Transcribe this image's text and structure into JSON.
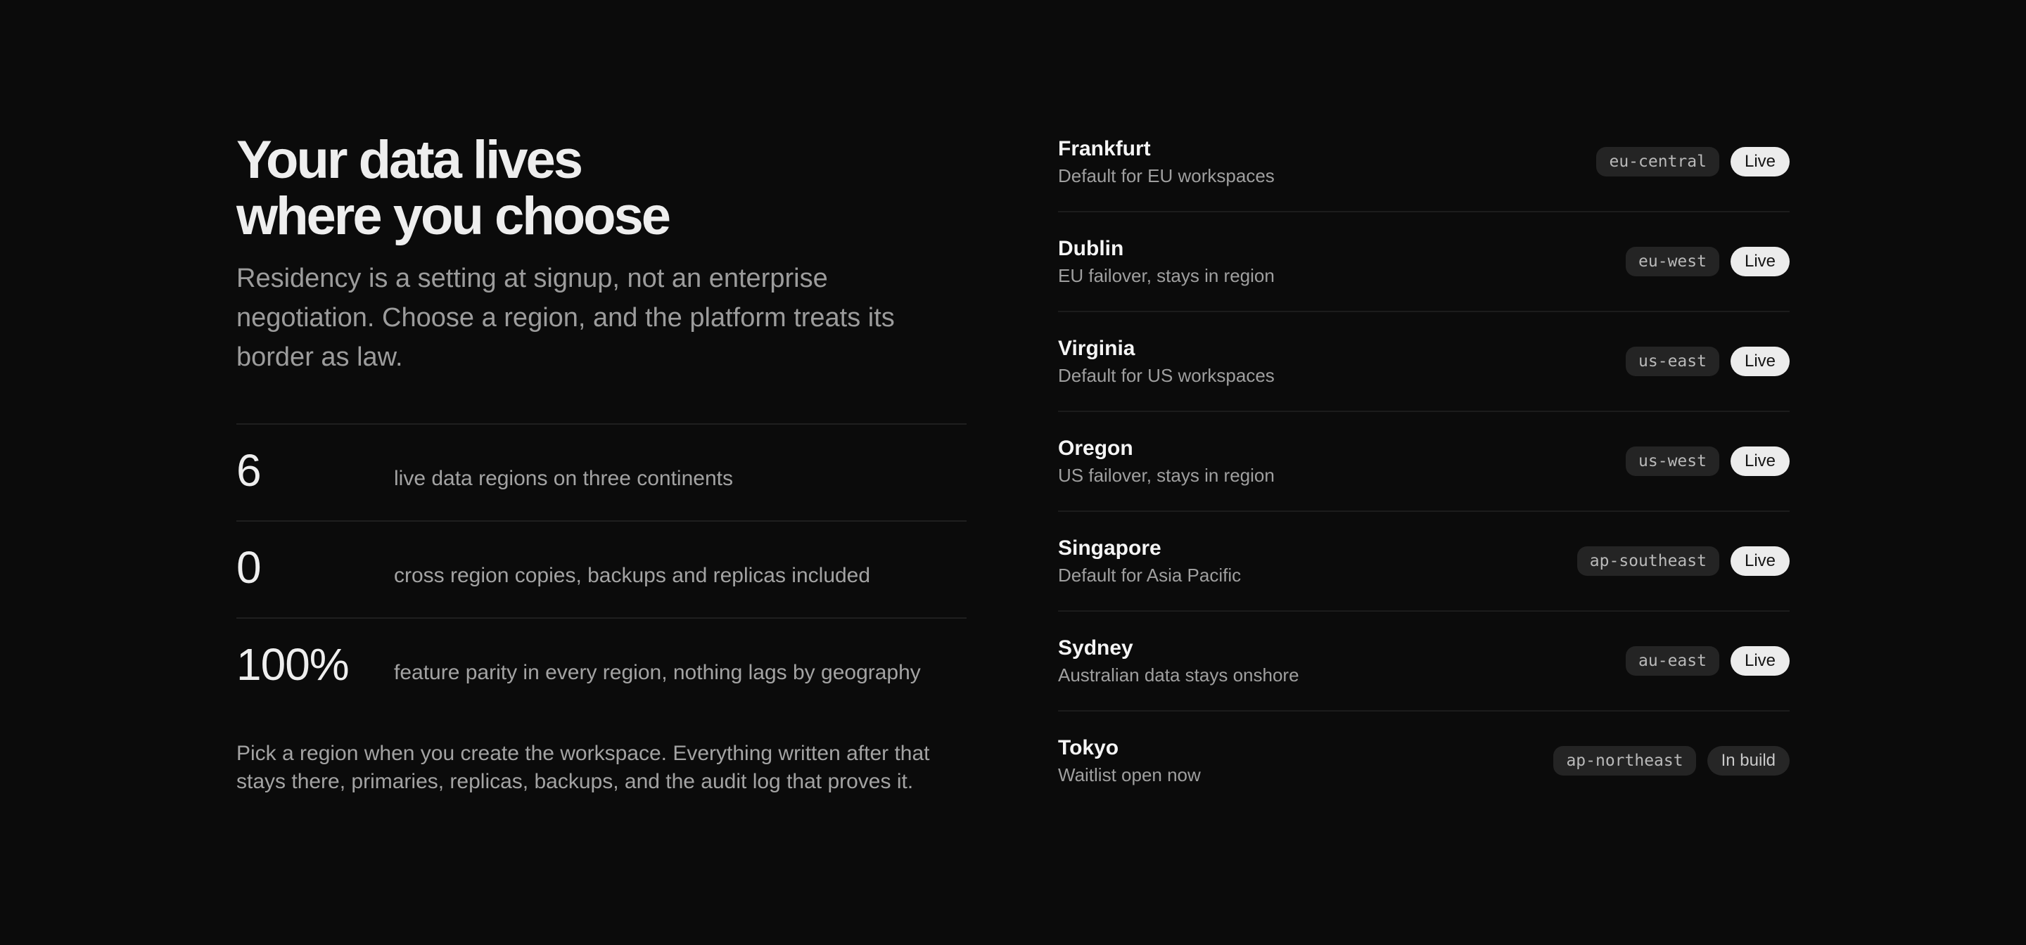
{
  "hero": {
    "headline_line1": "Your data lives",
    "headline_line2": "where you choose",
    "intro": "Residency is a setting at signup, not an enterprise negotiation. Choose a region, and the platform treats its border as law."
  },
  "stats": [
    {
      "value": "6",
      "description": "live data regions on three continents"
    },
    {
      "value": "0",
      "description": "cross region copies, backups and replicas included"
    },
    {
      "value": "100%",
      "description": "feature parity in every region, nothing lags by geography"
    }
  ],
  "footnote": "Pick a region when you create the workspace. Everything written after that stays there, primaries, replicas, backups, and the audit log that proves it.",
  "regions": [
    {
      "name": "Frankfurt",
      "note": "Default for EU workspaces",
      "code": "eu-central",
      "status": "Live"
    },
    {
      "name": "Dublin",
      "note": "EU failover, stays in region",
      "code": "eu-west",
      "status": "Live"
    },
    {
      "name": "Virginia",
      "note": "Default for US workspaces",
      "code": "us-east",
      "status": "Live"
    },
    {
      "name": "Oregon",
      "note": "US failover, stays in region",
      "code": "us-west",
      "status": "Live"
    },
    {
      "name": "Singapore",
      "note": "Default for Asia Pacific",
      "code": "ap-southeast",
      "status": "Live"
    },
    {
      "name": "Sydney",
      "note": "Australian data stays onshore",
      "code": "au-east",
      "status": "Live"
    },
    {
      "name": "Tokyo",
      "note": "Waitlist open now",
      "code": "ap-northeast",
      "status": "In build"
    }
  ],
  "colors": {
    "background": "#0b0b0b",
    "live_badge": "#ececec",
    "build_badge": "#262626",
    "code_tag": "#242424"
  }
}
